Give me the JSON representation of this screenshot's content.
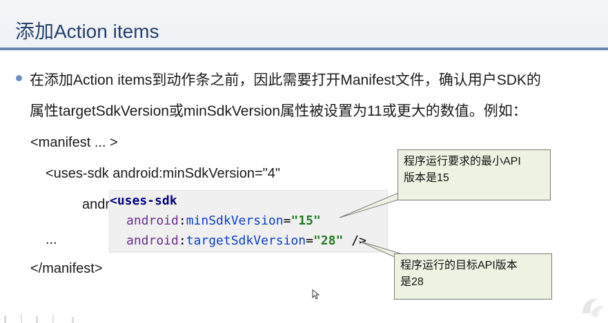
{
  "slide": {
    "title": "添加Action items",
    "bullet": {
      "line1": "在添加Action items到动作条之前，因此需要打开Manifest文件，确认用户SDK的",
      "line2": "属性targetSdkVersion或minSdkVersion属性被设置为11或更大的数值。例如："
    },
    "code": {
      "line1": "<manifest ... >",
      "line2": "<uses-sdk android:minSdkVersion=\"4\"",
      "line3_partial": "andr",
      "line4": "...",
      "line5": "</manifest>"
    },
    "code_box": {
      "open_tag": "<uses-sdk",
      "ns": "android",
      "colon": ":",
      "attr1_name": "minSdkVersion",
      "attr1_eq": "=",
      "attr1_value": "\"15\"",
      "attr2_name": "targetSdkVersion",
      "attr2_eq": "=",
      "attr2_value": "\"28\"",
      "close": "/>"
    },
    "callouts": {
      "min_api": {
        "line1": "程序运行要求的最小API",
        "line2": "版本是15"
      },
      "target_api": {
        "line1": "程序运行的目标API版本",
        "line2": "是28"
      }
    }
  },
  "colors": {
    "title": "#24406e",
    "title_rule": "#6d87b3",
    "bullet_dot": "#6f8fbf",
    "callout_fill": "#eef3e1",
    "code_tag": "#000080",
    "code_attr": "#0a3ec9",
    "code_value": "#1f7a1f"
  },
  "icons": {
    "cursor": "mouse-pointer-icon",
    "watermark": "player-logo-icon"
  }
}
